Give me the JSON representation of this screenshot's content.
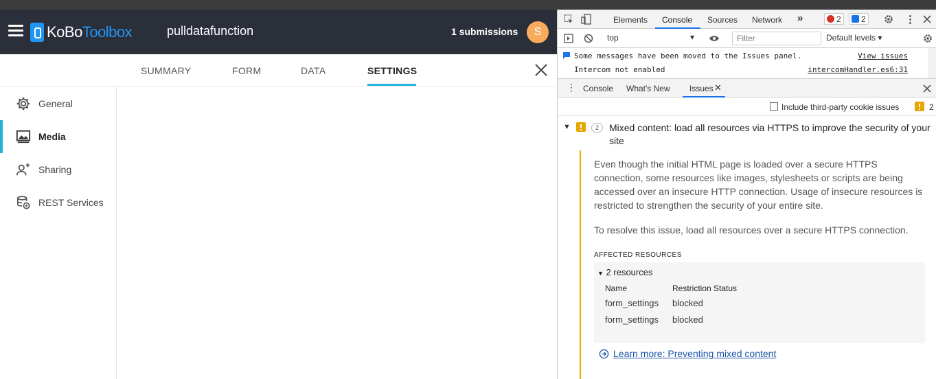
{
  "app": {
    "logo_main": "KoBo",
    "logo_accent": "Toolbox",
    "project_title": "pulldatafunction",
    "submissions": "1 submissions",
    "avatar_letter": "S",
    "tabs": [
      "SUMMARY",
      "FORM",
      "DATA",
      "SETTINGS"
    ],
    "active_tab": "SETTINGS",
    "sidebar": [
      {
        "label": "General",
        "icon": "gear-icon"
      },
      {
        "label": "Media",
        "icon": "media-icon"
      },
      {
        "label": "Sharing",
        "icon": "add-user-icon"
      },
      {
        "label": "REST Services",
        "icon": "rest-services-icon"
      }
    ],
    "active_sidebar": "Media",
    "colors": {
      "header": "#2b2f3a",
      "accent": "#27b3d6",
      "brand": "#2095f2",
      "avatar": "#f6ab5d"
    }
  },
  "devtools": {
    "tabs": [
      "Elements",
      "Console",
      "Sources",
      "Network"
    ],
    "active_tab": "Console",
    "error_count": "2",
    "message_count": "2",
    "context": "top",
    "filter_placeholder": "Filter",
    "levels": "Default levels",
    "messages": [
      {
        "text": "Some messages have been moved to the Issues panel.",
        "link": "View issues"
      },
      {
        "text": "Intercom not enabled",
        "link": "intercomHandler.es6:31"
      }
    ],
    "drawer_tabs": [
      "Console",
      "What's New",
      "Issues"
    ],
    "active_drawer_tab": "Issues",
    "third_party_label": "Include third-party cookie issues",
    "warning_count": "2",
    "issue": {
      "count": "2",
      "title": "Mixed content: load all resources via HTTPS to improve the security of your site",
      "para1": "Even though the initial HTML page is loaded over a secure HTTPS connection, some resources like images, stylesheets or scripts are being accessed over an insecure HTTP connection. Usage of insecure resources is restricted to strengthen the security of your entire site.",
      "para2": "To resolve this issue, load all resources over a secure HTTPS connection.",
      "affected_label": "AFFECTED RESOURCES",
      "resources_header": "2 resources",
      "col_name": "Name",
      "col_status": "Restriction Status",
      "rows": [
        {
          "name": "form_settings",
          "status": "blocked"
        },
        {
          "name": "form_settings",
          "status": "blocked"
        }
      ],
      "learn_more": "Learn more: Preventing mixed content"
    }
  }
}
